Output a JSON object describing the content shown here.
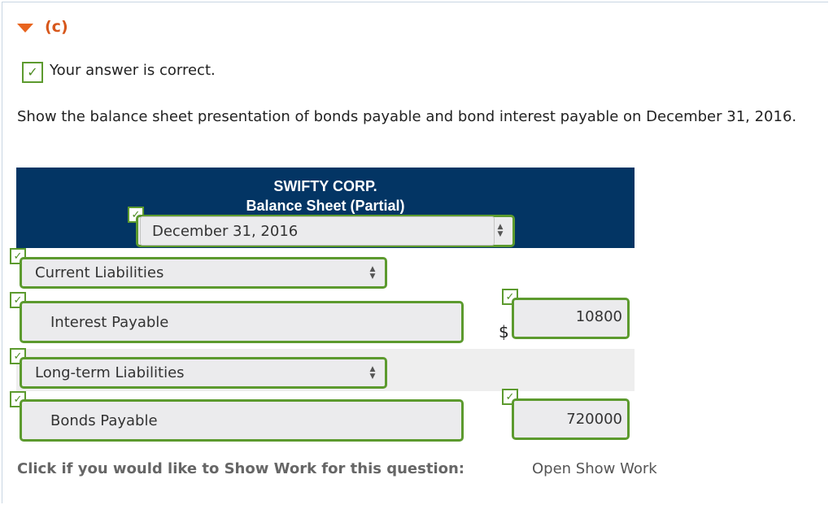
{
  "section": {
    "label": "(c)",
    "icon": "triangle-down-icon",
    "accent": "#e8641e"
  },
  "feedback": {
    "text": "Your answer is correct.",
    "icon": "checkmark-icon",
    "color": "#5c9a2e"
  },
  "question": {
    "text": "Show the balance sheet presentation of bonds payable and bond interest payable on December 31, 2016."
  },
  "statement": {
    "company": "SWIFTY CORP.",
    "title": "Balance Sheet (Partial)",
    "header_color": "#033564",
    "date_select": {
      "value": "December 31, 2016"
    }
  },
  "rows": {
    "current_liabilities": {
      "value": "Current Liabilities"
    },
    "interest_payable": {
      "label": "Interest Payable",
      "currency": "$",
      "amount": "10800"
    },
    "long_term_liabilities": {
      "value": "Long-term Liabilities"
    },
    "bonds_payable": {
      "label": "Bonds Payable",
      "amount": "720000"
    }
  },
  "footer": {
    "prompt": "Click if you would like to Show Work for this question:",
    "link": "Open Show Work"
  }
}
